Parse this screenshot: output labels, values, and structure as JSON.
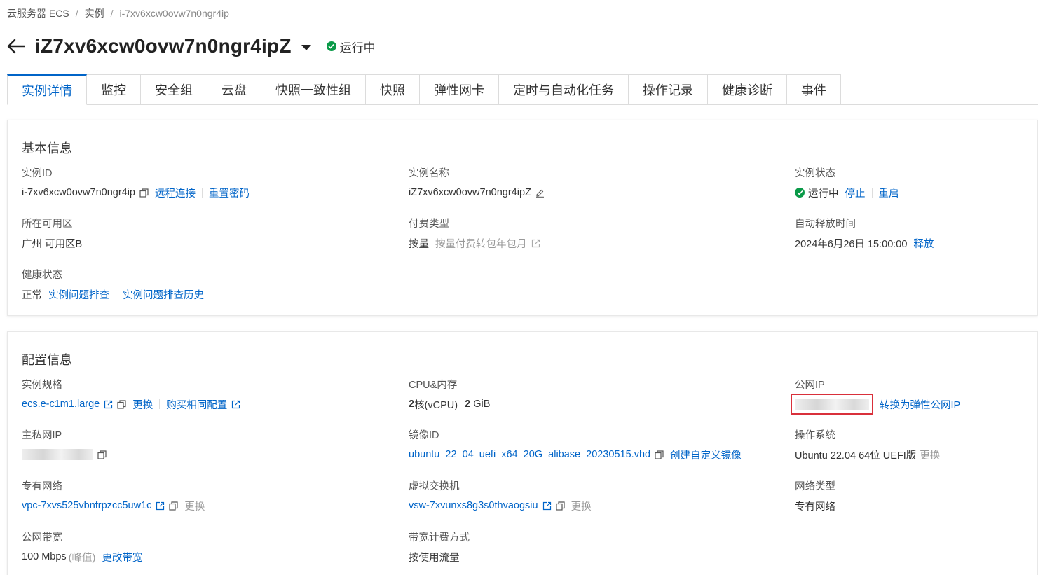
{
  "breadcrumb": {
    "root": "云服务器 ECS",
    "middle": "实例",
    "current": "i-7xv6xcw0ovw7n0ngr4ip"
  },
  "header": {
    "title": "iZ7xv6xcw0ovw7n0ngr4ipZ",
    "status": "运行中"
  },
  "tabs": [
    {
      "label": "实例详情",
      "active": true
    },
    {
      "label": "监控"
    },
    {
      "label": "安全组"
    },
    {
      "label": "云盘"
    },
    {
      "label": "快照一致性组"
    },
    {
      "label": "快照"
    },
    {
      "label": "弹性网卡"
    },
    {
      "label": "定时与自动化任务"
    },
    {
      "label": "操作记录"
    },
    {
      "label": "健康诊断"
    },
    {
      "label": "事件"
    }
  ],
  "basic": {
    "title": "基本信息",
    "instance_id": {
      "label": "实例ID",
      "value": "i-7xv6xcw0ovw7n0ngr4ip",
      "remote_connect": "远程连接",
      "reset_password": "重置密码"
    },
    "instance_name": {
      "label": "实例名称",
      "value": "iZ7xv6xcw0ovw7n0ngr4ipZ"
    },
    "instance_status": {
      "label": "实例状态",
      "value": "运行中",
      "stop": "停止",
      "restart": "重启"
    },
    "zone": {
      "label": "所在可用区",
      "value": "广州 可用区B"
    },
    "billing": {
      "label": "付费类型",
      "value": "按量",
      "convert": "按量付费转包年包月"
    },
    "auto_release": {
      "label": "自动释放时间",
      "value": "2024年6月26日 15:00:00",
      "release": "释放"
    },
    "health": {
      "label": "健康状态",
      "value": "正常",
      "troubleshoot": "实例问题排查",
      "history": "实例问题排查历史"
    }
  },
  "config": {
    "title": "配置信息",
    "spec": {
      "label": "实例规格",
      "value": "ecs.e-c1m1.large",
      "change": "更换",
      "buy_same": "购买相同配置"
    },
    "cpu_mem": {
      "label": "CPU&内存",
      "cpu_num": "2",
      "cpu_unit": "核(vCPU)",
      "mem_num": "2",
      "mem_unit": "GiB"
    },
    "public_ip": {
      "label": "公网IP",
      "convert": "转换为弹性公网IP"
    },
    "private_ip": {
      "label": "主私网IP"
    },
    "image_id": {
      "label": "镜像ID",
      "value": "ubuntu_22_04_uefi_x64_20G_alibase_20230515.vhd",
      "create_image": "创建自定义镜像"
    },
    "os": {
      "label": "操作系统",
      "value": "Ubuntu 22.04 64位 UEFI版",
      "change": "更换"
    },
    "vpc": {
      "label": "专有网络",
      "value": "vpc-7xvs525vbnfrpzcc5uw1c",
      "change": "更换"
    },
    "vswitch": {
      "label": "虚拟交换机",
      "value": "vsw-7xvunxs8g3s0thvaogsiu",
      "change": "更换"
    },
    "network_type": {
      "label": "网络类型",
      "value": "专有网络"
    },
    "bandwidth": {
      "label": "公网带宽",
      "value": "100 Mbps",
      "peak": "(峰值)",
      "change": "更改带宽"
    },
    "bw_billing": {
      "label": "带宽计费方式",
      "value": "按使用流量"
    }
  },
  "colors": {
    "link": "#0064c8",
    "status_green": "#0a9a48",
    "highlight_red": "#d9303b"
  }
}
